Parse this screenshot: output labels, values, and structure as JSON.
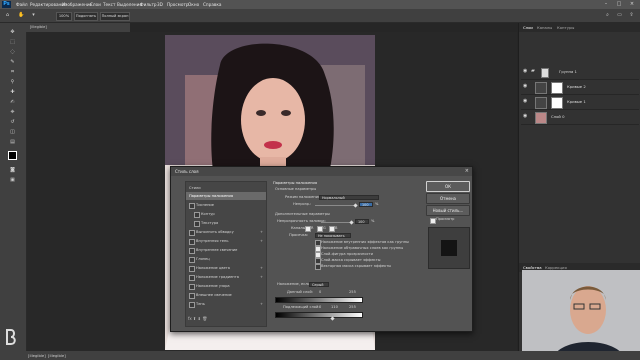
{
  "menubar": {
    "app_badge": "Ps",
    "items": [
      "Файл",
      "Редактирование",
      "Изображение",
      "Слои",
      "Текст",
      "Выделение",
      "Фильтр",
      "3D",
      "Просмотр",
      "Окно",
      "Справка"
    ],
    "window_controls": [
      "–",
      "□",
      "×"
    ]
  },
  "options_bar": {
    "zoom": "100%",
    "fit_screen": "Подогнать",
    "fill_screen": "Полный экран"
  },
  "document_tab": "[illegible]",
  "status_bar": {
    "zoom": "[illegible]",
    "doc_info": "[illegible]"
  },
  "right_panel": {
    "tabs": [
      "Слои",
      "Каналы",
      "Контуры"
    ],
    "layers": [
      {
        "name": "Группа 1"
      },
      {
        "name": "Кривые 2"
      },
      {
        "name": "Кривые 1"
      },
      {
        "name": "Слой 0"
      }
    ],
    "lower_tabs": [
      "Свойства",
      "Коррекция"
    ]
  },
  "dialog": {
    "title": "Стиль слоя",
    "close": "×",
    "styles": [
      {
        "label": "Стили",
        "checkbox": false,
        "plus": false
      },
      {
        "label": "Параметры наложения",
        "checkbox": false,
        "plus": false,
        "selected": true
      },
      {
        "label": "Тиснение",
        "checkbox": true,
        "plus": false
      },
      {
        "label": "Контур",
        "checkbox": true,
        "plus": false,
        "indent": true
      },
      {
        "label": "Текстура",
        "checkbox": true,
        "plus": false,
        "indent": true
      },
      {
        "label": "Выполнить обводку",
        "checkbox": true,
        "plus": true
      },
      {
        "label": "Внутренняя тень",
        "checkbox": true,
        "plus": true
      },
      {
        "label": "Внутреннее свечение",
        "checkbox": true,
        "plus": false
      },
      {
        "label": "Глянец",
        "checkbox": true,
        "plus": false
      },
      {
        "label": "Наложение цвета",
        "checkbox": true,
        "plus": true
      },
      {
        "label": "Наложение градиента",
        "checkbox": true,
        "plus": true
      },
      {
        "label": "Наложение узора",
        "checkbox": true,
        "plus": false
      },
      {
        "label": "Внешнее свечение",
        "checkbox": true,
        "plus": false
      },
      {
        "label": "Тень",
        "checkbox": true,
        "plus": true
      }
    ],
    "fx_icons": "fx ⬆ ⬇ 🗑",
    "options": {
      "section_title": "Параметры наложения",
      "general_title": "Основные параметры",
      "blend_mode_label": "Режим наложения:",
      "blend_mode_value": "Нормальный",
      "opacity_label": "Непрозр.:",
      "opacity_value": "100",
      "opacity_unit": "%",
      "advanced_title": "Дополнительные параметры",
      "fill_opacity_label": "Непрозрачность заливки:",
      "fill_opacity_value": "100",
      "fill_opacity_unit": "%",
      "channels_label": "Каналы:",
      "channels": [
        "R",
        "G",
        "B"
      ],
      "knockout_label": "Просечка:",
      "knockout_value": "Не показывать",
      "checkboxes": [
        {
          "label": "Наложение внутренних эффектов как группы",
          "checked": false
        },
        {
          "label": "Наложение обтравочных слоев как группы",
          "checked": true
        },
        {
          "label": "Слой-фигура прозрачности",
          "checked": true
        },
        {
          "label": "Слой-маска скрывает эффекты",
          "checked": false
        },
        {
          "label": "Векторная маска скрывает эффекты",
          "checked": false
        }
      ],
      "blend_if_label": "Наложение, если:",
      "blend_if_value": "Серый",
      "this_layer_label": "Данный слой:",
      "this_layer_values": [
        "0",
        "255"
      ],
      "underlying_label": "Подлежащий слой:",
      "underlying_values": [
        "0",
        "110",
        "255"
      ]
    },
    "buttons": {
      "ok": "ОК",
      "cancel": "Отмена",
      "new_style": "Новый стиль...",
      "preview_label": "Просмотр"
    }
  }
}
